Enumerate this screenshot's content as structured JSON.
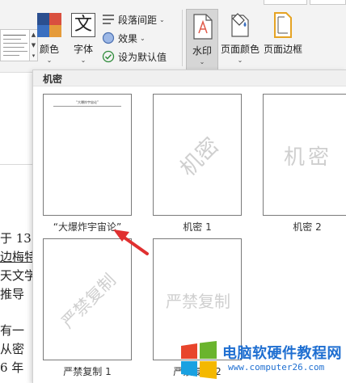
{
  "ribbon": {
    "colors_label": "颜色",
    "fonts_label": "字体",
    "fonts_icon_text": "文",
    "paragraph_spacing_label": "段落间距",
    "effects_label": "效果",
    "set_default_label": "设为默认值",
    "watermark_label": "水印",
    "page_color_label": "页面颜色",
    "page_border_label": "页面边框"
  },
  "document": {
    "lines": [
      "于 13",
      "边梅特",
      "天文学",
      "推导",
      "有一",
      "从密",
      "6 年"
    ]
  },
  "watermark_menu": {
    "section_title": "机密",
    "items": [
      {
        "caption": "“大爆炸宇宙论”",
        "watermark_text": "“大爆炸宇宙论”",
        "style": "header"
      },
      {
        "caption": "机密 1",
        "watermark_text": "机密",
        "style": "diagonal"
      },
      {
        "caption": "机密 2",
        "watermark_text": "机密",
        "style": "horizontal"
      },
      {
        "caption": "严禁复制 1",
        "watermark_text": "严禁复制",
        "style": "diagonal"
      },
      {
        "caption": "严禁复制 2",
        "watermark_text": "严禁复制",
        "style": "horizontal"
      }
    ]
  },
  "logo": {
    "name": "电脑软硬件教程网",
    "url": "www.computer26.com"
  },
  "colors": {
    "annotation_arrow": "#e03030",
    "logo_text": "#1f6fd1",
    "watermark_gray": "#cfcfcf"
  }
}
